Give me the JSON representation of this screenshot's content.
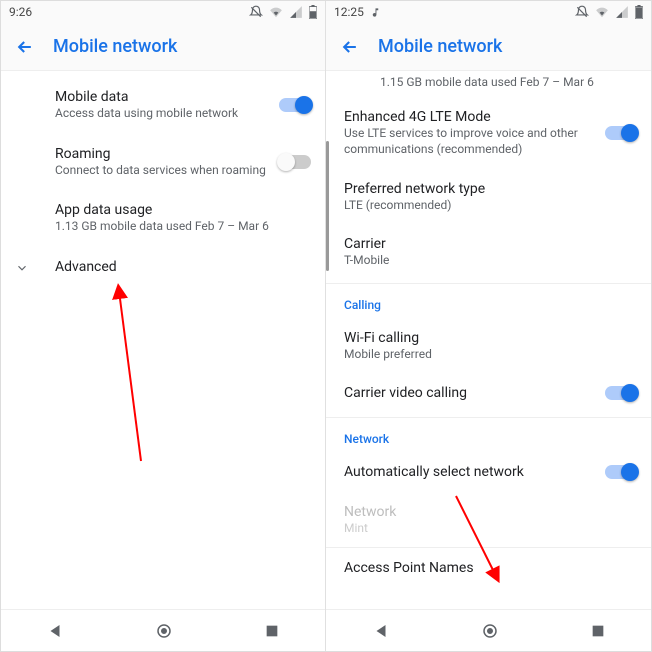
{
  "left": {
    "statusbar": {
      "time": "9:26"
    },
    "header": {
      "title": "Mobile network"
    },
    "rows": {
      "mobile_data": {
        "title": "Mobile data",
        "sub": "Access data using mobile network"
      },
      "roaming": {
        "title": "Roaming",
        "sub": "Connect to data services when roaming"
      },
      "app_data": {
        "title": "App data usage",
        "sub": "1.13 GB mobile data used Feb 7 – Mar 6"
      },
      "advanced": {
        "title": "Advanced"
      }
    }
  },
  "right": {
    "statusbar": {
      "time": "12:25"
    },
    "header": {
      "title": "Mobile network"
    },
    "usage_sub": "1.15 GB mobile data used Feb 7 – Mar 6",
    "lte": {
      "title": "Enhanced 4G LTE Mode",
      "sub": "Use LTE services to improve voice and other communications (recommended)"
    },
    "pref": {
      "title": "Preferred network type",
      "sub": "LTE (recommended)"
    },
    "carrier": {
      "title": "Carrier",
      "sub": "T-Mobile"
    },
    "section_calling": "Calling",
    "wifi_calling": {
      "title": "Wi-Fi calling",
      "sub": "Mobile preferred"
    },
    "carrier_video": {
      "title": "Carrier video calling"
    },
    "section_network": "Network",
    "auto_select": {
      "title": "Automatically select network"
    },
    "network": {
      "title": "Network",
      "sub": "Mint"
    },
    "apn": {
      "title": "Access Point Names"
    }
  }
}
